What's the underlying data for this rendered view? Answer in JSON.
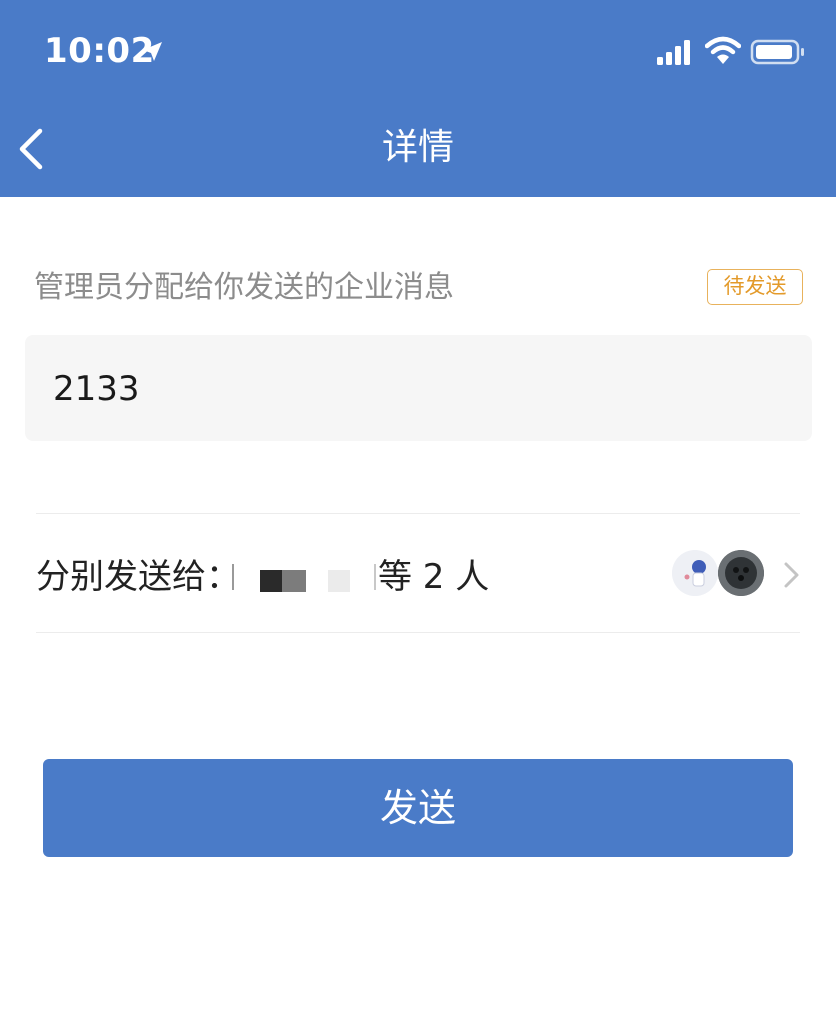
{
  "status_bar": {
    "time": "10:02",
    "icons": [
      "location-arrow-icon",
      "cellular-signal-icon",
      "wifi-icon",
      "battery-icon"
    ]
  },
  "nav": {
    "title": "详情",
    "back_icon": "chevron-left-icon"
  },
  "message": {
    "label": "管理员分配给你发送的企业消息",
    "status_badge": "待发送",
    "content": "2133"
  },
  "recipients": {
    "label": "分别发送给：",
    "count_text": "等 2 人",
    "avatars": [
      "avatar-user-1",
      "avatar-user-2"
    ]
  },
  "actions": {
    "send_label": "发送"
  },
  "colors": {
    "brand_blue": "#4a7bc8",
    "badge_orange": "#e39a2a",
    "badge_border": "#e8b25c",
    "content_bg": "#f6f6f6",
    "muted_text": "#8c8c8c"
  }
}
